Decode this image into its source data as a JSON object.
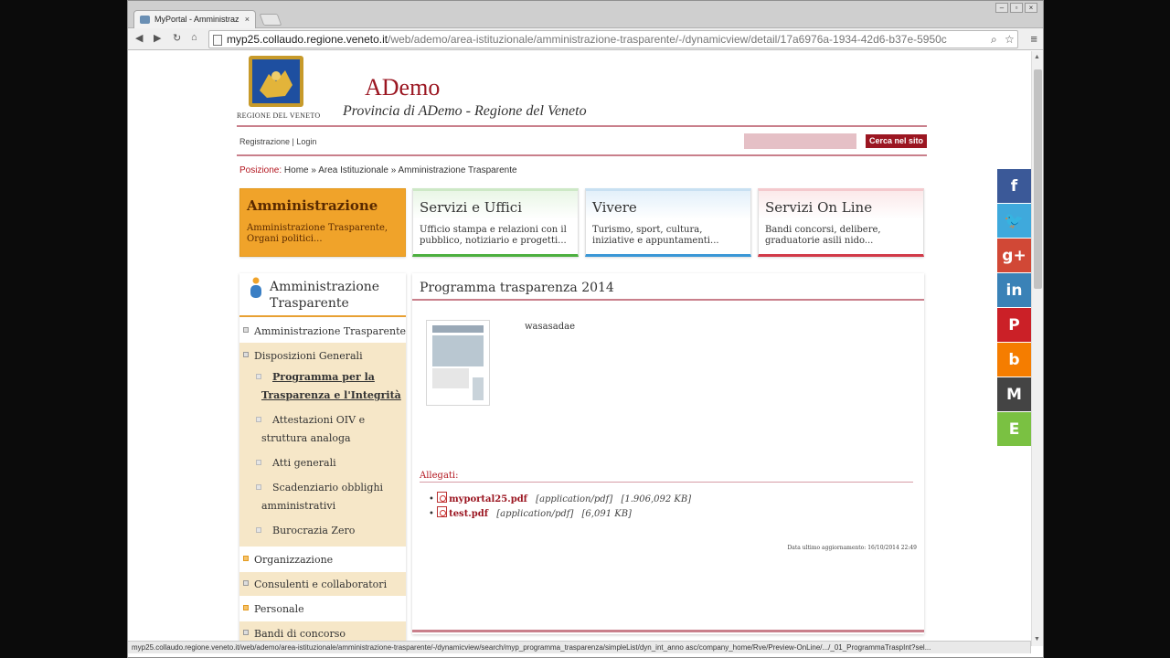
{
  "browser": {
    "tab_title": "MyPortal - Amministraz",
    "url_host": "myp25.collaudo.regione.veneto.it",
    "url_path": "/web/ademo/area-istituzionale/amministrazione-trasparente/-/dynamicview/detail/17a6976a-1934-42d6-b37e-5950c",
    "status_url": "myp25.collaudo.regione.veneto.it/web/ademo/area-istituzionale/amministrazione-trasparente/-/dynamicview/search/myp_programma_trasparenza/simpleList/dyn_int_anno asc/company_home/Rve/Preview-OnLine/.../_01_ProgrammaTraspInt?sel..."
  },
  "header": {
    "logo_text": "REGIONE DEL VENETO",
    "title": "ADemo",
    "subtitle": "Provincia di ADemo - Regione del Veneto",
    "links": "Registrazione | Login",
    "search_button": "Cerca nel sito",
    "search_value": ""
  },
  "breadcrumb": {
    "label": "Posizione:",
    "home": "Home",
    "sep1": "»",
    "area": "Area Istituzionale",
    "sep2": "»",
    "current": "Amministrazione Trasparente"
  },
  "cards": [
    {
      "title": "Amministrazione",
      "text": "Amministrazione Trasparente, Organi politici..."
    },
    {
      "title": "Servizi e Uffici",
      "text": "Ufficio stampa e relazioni con il pubblico, notiziario e progetti..."
    },
    {
      "title": "Vivere",
      "text": "Turismo, sport, cultura, iniziative e appuntamenti..."
    },
    {
      "title": "Servizi On Line",
      "text": "Bandi concorsi, delibere, graduatorie asili nido..."
    }
  ],
  "sidebar": {
    "heading": "Amministrazione Trasparente",
    "items": [
      {
        "label": "Amministrazione Trasparente"
      },
      {
        "label": "Disposizioni Generali"
      },
      {
        "label": "Organizzazione"
      },
      {
        "label": "Consulenti e collaboratori"
      },
      {
        "label": "Personale"
      },
      {
        "label": "Bandi di concorso"
      }
    ],
    "subitems": [
      {
        "label": "Programma per la Trasparenza e l'Integrità"
      },
      {
        "label": "Attestazioni OIV e struttura analoga"
      },
      {
        "label": "Atti generali"
      },
      {
        "label": "Scadenziario obblighi amministrativi"
      },
      {
        "label": "Burocrazia Zero"
      }
    ]
  },
  "content": {
    "title": "Programma trasparenza 2014",
    "description": "wasasadae",
    "attachments_label": "Allegati:",
    "attachments": [
      {
        "name": "myportal25.pdf",
        "type": "[application/pdf]",
        "size": "[1.906,092 KB]"
      },
      {
        "name": "test.pdf",
        "type": "[application/pdf]",
        "size": "[6,091 KB]"
      }
    ],
    "updated": "Data ultimo aggiornamento: 16/10/2014 22:49"
  },
  "social": [
    {
      "icon": "facebook-icon",
      "glyph": "f",
      "color": "#3b5998"
    },
    {
      "icon": "twitter-icon",
      "glyph": "🐦",
      "color": "#3fa9dc"
    },
    {
      "icon": "google-plus-icon",
      "glyph": "g+",
      "color": "#d14836"
    },
    {
      "icon": "linkedin-icon",
      "glyph": "in",
      "color": "#3a82b7"
    },
    {
      "icon": "pinterest-icon",
      "glyph": "P",
      "color": "#cb2027"
    },
    {
      "icon": "blogger-icon",
      "glyph": "b",
      "color": "#f57d00"
    },
    {
      "icon": "gmail-icon",
      "glyph": "M",
      "color": "#444444"
    },
    {
      "icon": "evernote-icon",
      "glyph": "E",
      "color": "#7ac142"
    }
  ]
}
